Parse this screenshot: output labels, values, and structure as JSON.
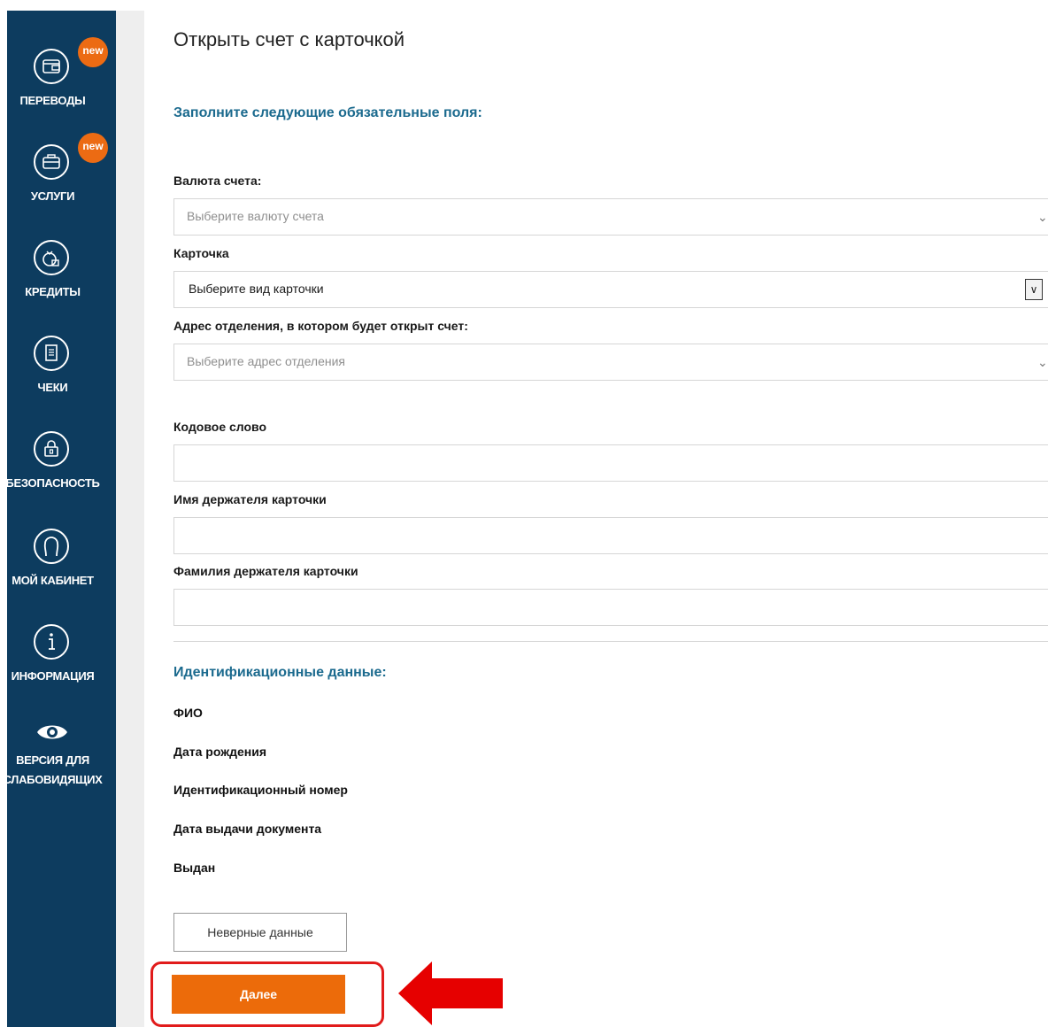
{
  "sidebar": {
    "items": [
      {
        "label": "ПЕРЕВОДЫ",
        "icon": "wallet-icon",
        "badge": "new"
      },
      {
        "label": "УСЛУГИ",
        "icon": "briefcase-icon",
        "badge": "new"
      },
      {
        "label": "КРЕДИТЫ",
        "icon": "money-bag-icon"
      },
      {
        "label": "ЧЕКИ",
        "icon": "receipt-icon"
      },
      {
        "label": "БЕЗОПАСНОСТЬ",
        "icon": "lock-icon"
      },
      {
        "label": "МОЙ КАБИНЕТ",
        "icon": "user-icon"
      },
      {
        "label": "ИНФОРМАЦИЯ",
        "icon": "info-icon"
      },
      {
        "label_line1": "ВЕРСИЯ ДЛЯ",
        "label_line2": "СЛАБОВИДЯЩИХ",
        "icon": "eye-icon"
      }
    ]
  },
  "page": {
    "title": "Открыть счет с карточкой",
    "required_heading": "Заполните следующие обязательные поля:",
    "currency": {
      "label": "Валюта счета:",
      "placeholder": "Выберите валюту счета"
    },
    "card": {
      "label": "Карточка",
      "value": "Выберите вид карточки"
    },
    "branch": {
      "label": "Адрес отделения, в котором будет открыт счет:",
      "placeholder": "Выберите адрес отделения"
    },
    "code_word": {
      "label": "Кодовое слово",
      "value": ""
    },
    "holder_name": {
      "label": "Имя держателя карточки",
      "value": ""
    },
    "holder_surname": {
      "label": "Фамилия держателя карточки",
      "value": ""
    },
    "id_heading": "Идентификационные данные:",
    "id_fields": [
      "ФИО",
      "Дата рождения",
      "Идентификационный номер",
      "Дата выдачи документа",
      "Выдан"
    ],
    "wrong_data_button": "Неверные данные",
    "next_button": "Далее"
  },
  "colors": {
    "sidebar_bg": "#0d3c5f",
    "accent_orange": "#ec6b0a",
    "heading_blue": "#1b6a8e",
    "highlight_red": "#e11b1b"
  }
}
